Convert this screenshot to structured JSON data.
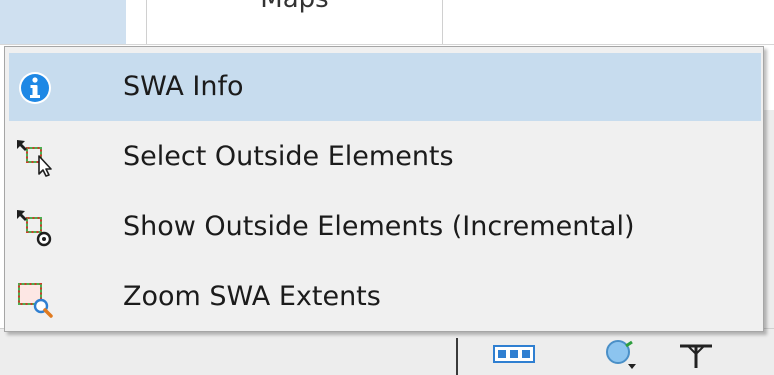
{
  "background": {
    "ribbon_group_label": "Maps"
  },
  "menu": {
    "items": [
      {
        "label": "SWA Info",
        "icon": "info-icon",
        "highlighted": true
      },
      {
        "label": "Select Outside Elements",
        "icon": "select-outside-elements-icon",
        "highlighted": false
      },
      {
        "label": "Show Outside Elements (Incremental)",
        "icon": "show-outside-elements-icon",
        "highlighted": false
      },
      {
        "label": "Zoom SWA Extents",
        "icon": "zoom-extents-icon",
        "highlighted": false
      }
    ]
  },
  "colors": {
    "highlight": "#c7dcee",
    "menu_background": "#f0f0f0",
    "info_blue": "#1e88e5"
  }
}
